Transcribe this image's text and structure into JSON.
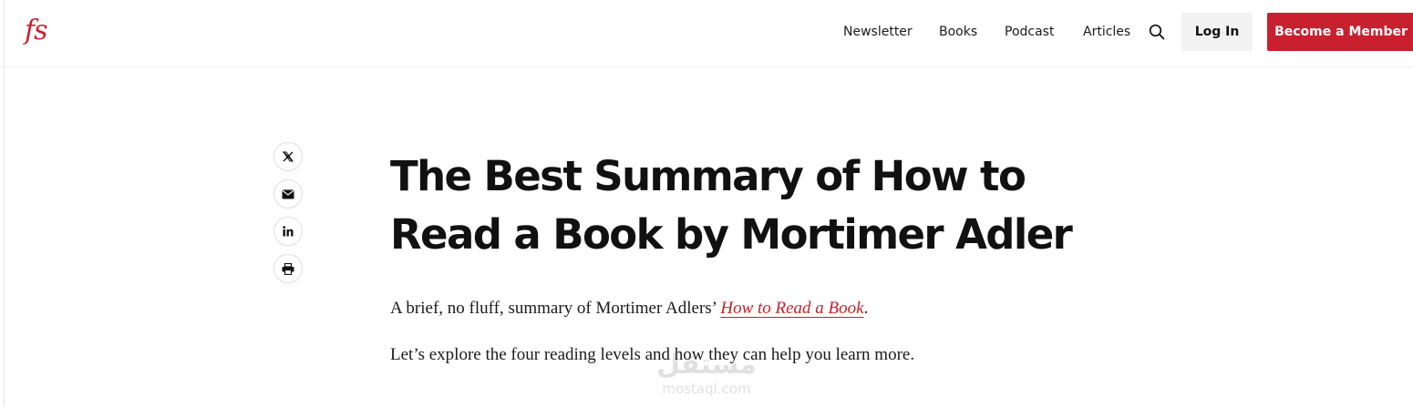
{
  "brand": {
    "logo_text": "fs",
    "accent_color": "#c8202f"
  },
  "nav": {
    "items": [
      {
        "label": "Newsletter"
      },
      {
        "label": "Books"
      },
      {
        "label": "Podcast"
      },
      {
        "label": "Articles"
      }
    ],
    "search_icon": "search-icon",
    "login_label": "Log In",
    "member_label": "Become a Member"
  },
  "share": {
    "icons": [
      "x-twitter-icon",
      "envelope-icon",
      "linkedin-icon",
      "printer-icon"
    ]
  },
  "article": {
    "title": "The Best Summary of How to Read a Book by Mortimer Adler",
    "intro_before_link": "A brief, no fluff, summary of Mortimer Adlers’ ",
    "intro_link": "How to Read a Book",
    "intro_after_link": ".",
    "second_paragraph": "Let’s explore the four reading levels and how they can help you learn more."
  },
  "watermark": {
    "arabic": "مستقل",
    "latin": "mostaql.com"
  }
}
